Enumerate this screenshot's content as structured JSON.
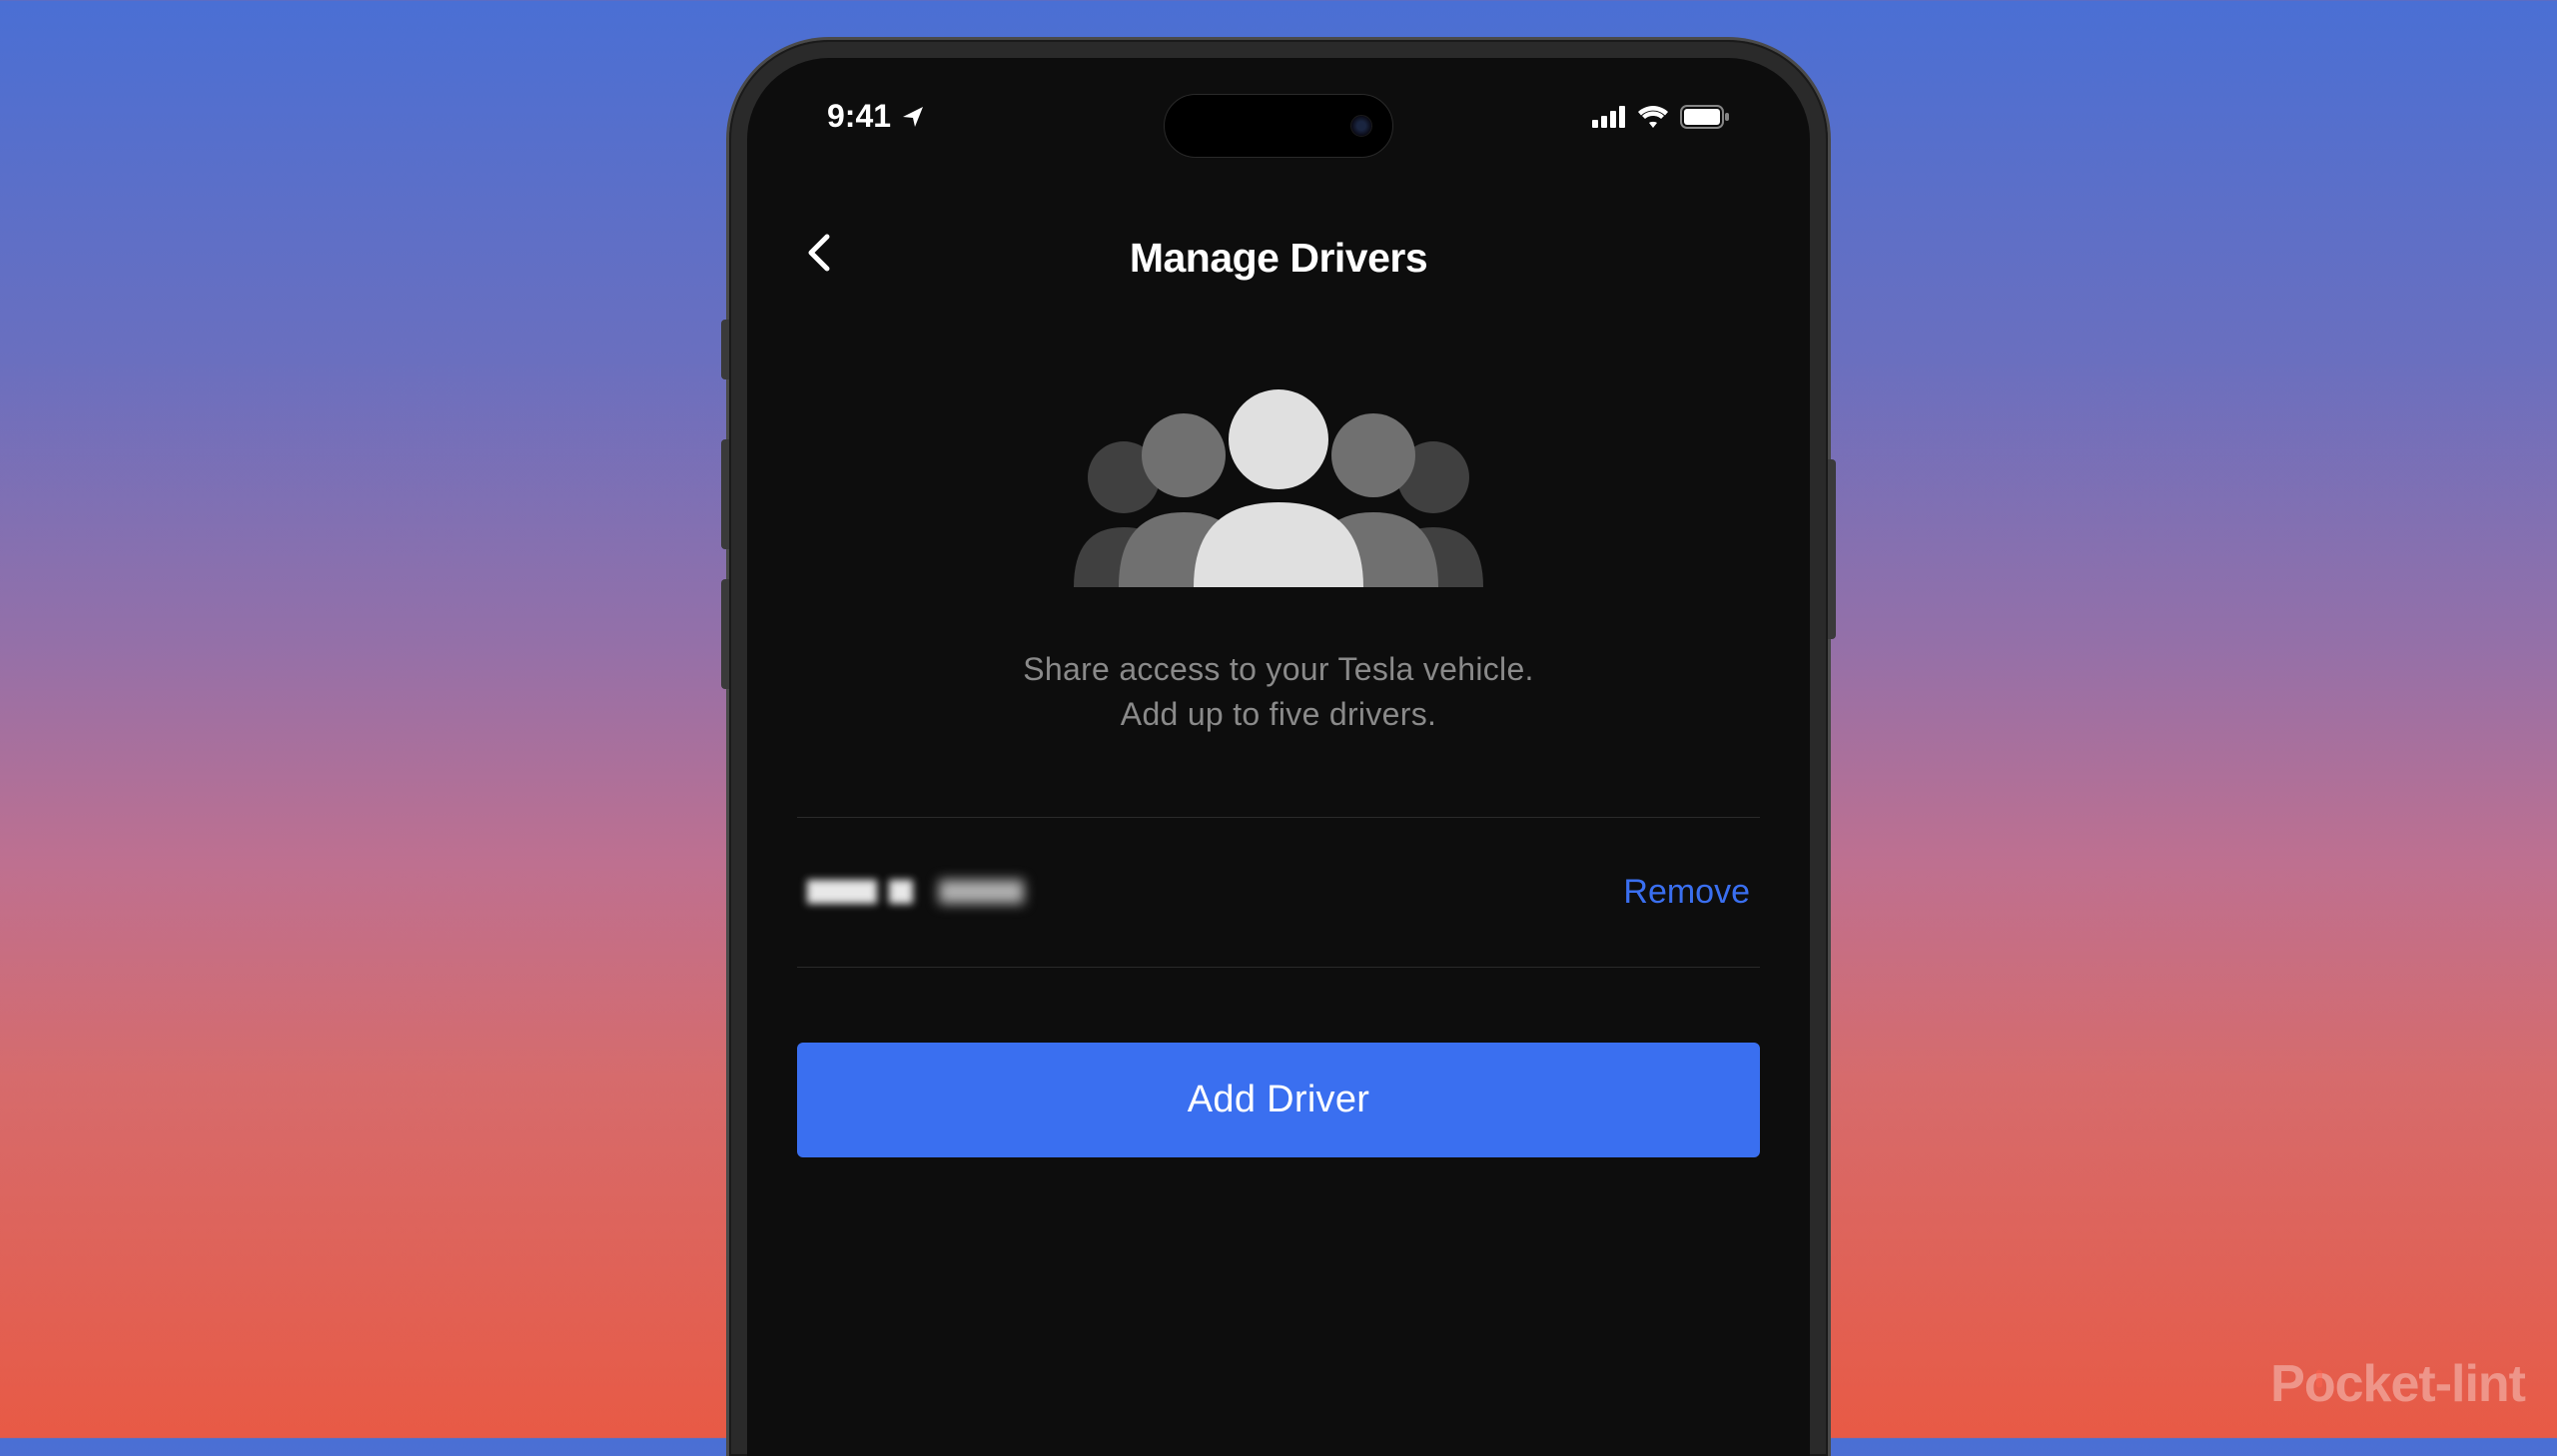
{
  "status_bar": {
    "time": "9:41"
  },
  "header": {
    "title": "Manage Drivers"
  },
  "description": {
    "line1": "Share access to your Tesla vehicle.",
    "line2": "Add up to five drivers."
  },
  "drivers": [
    {
      "name_redacted": true,
      "remove_label": "Remove"
    }
  ],
  "actions": {
    "add_driver_label": "Add Driver"
  },
  "watermark": {
    "text_before": "P",
    "text_after": "cket-lint"
  },
  "colors": {
    "accent": "#3A6FF0",
    "background": "#0d0d0d",
    "text_primary": "#ffffff",
    "text_secondary": "#8a8a8a"
  }
}
